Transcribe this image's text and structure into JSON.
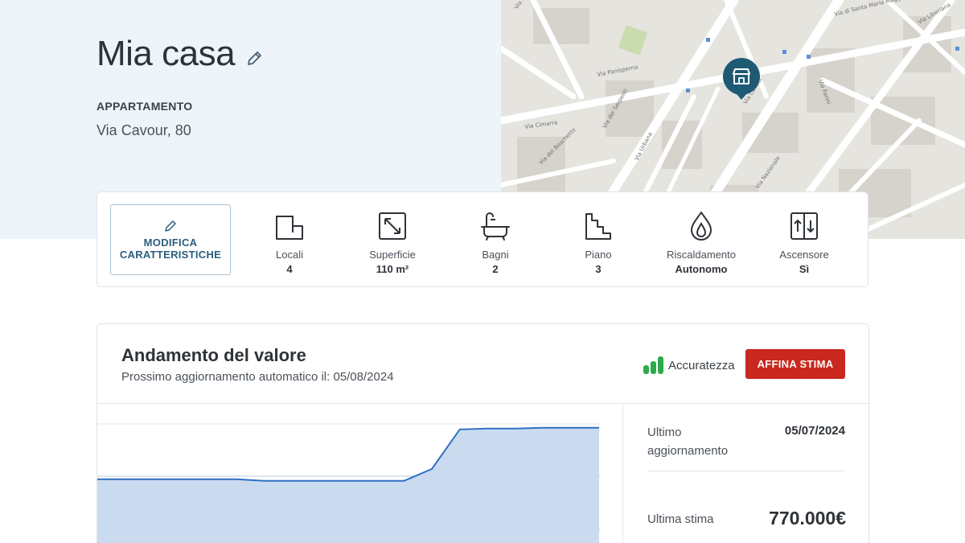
{
  "header": {
    "title": "Mia casa",
    "property_type": "APPARTAMENTO",
    "address": "Via Cavour, 80"
  },
  "map": {
    "streets": [
      "Via Milano",
      "Via Panisperna",
      "Via Cavour",
      "Via di Santa Maria Maggiore",
      "Via dei Serpenti",
      "Via Urbana",
      "Via Cimarra",
      "Via del Boschetto",
      "Via Nazionale",
      "Via Farini",
      "Via Liberiana"
    ],
    "marker_icon": "house-marker-icon"
  },
  "features": {
    "modify_button_label": "MODIFICA CARATTERISTICHE",
    "items": [
      {
        "icon": "rooms-icon",
        "name": "Locali",
        "value": "4"
      },
      {
        "icon": "area-icon",
        "name": "Superficie",
        "value": "110 m²"
      },
      {
        "icon": "bathtub-icon",
        "name": "Bagni",
        "value": "2"
      },
      {
        "icon": "stairs-icon",
        "name": "Piano",
        "value": "3"
      },
      {
        "icon": "heating-icon",
        "name": "Riscaldamento",
        "value": "Autonomo"
      },
      {
        "icon": "elevator-icon",
        "name": "Ascensore",
        "value": "Sì"
      }
    ]
  },
  "value_trend": {
    "title": "Andamento del valore",
    "subtitle": "Prossimo aggiornamento automatico il: 05/08/2024",
    "accuracy_label": "Accuratezza",
    "refine_button": "AFFINA STIMA",
    "last_update_label": "Ultimo aggiornamento",
    "last_update_value": "05/07/2024",
    "last_estimate_label": "Ultima stima",
    "last_estimate_value": "770.000€"
  },
  "colors": {
    "accent": "#2b5e7e",
    "cta": "#c8281d",
    "accuracy_green": "#2eaa4a",
    "chart_line": "#2f6fc4",
    "chart_fill": "#c7d9ef"
  },
  "chart_data": {
    "type": "area",
    "series": [
      {
        "values": [
          705,
          705,
          705,
          705,
          705,
          705,
          703,
          703,
          703,
          703,
          703,
          703,
          718,
          768,
          769,
          769,
          770,
          770,
          770
        ]
      }
    ]
  }
}
